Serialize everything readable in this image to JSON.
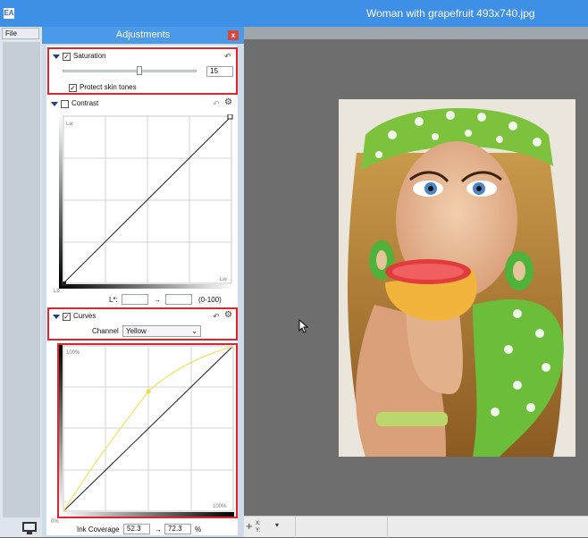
{
  "app": {
    "icon_text": "EA",
    "document_title": "Woman with grapefruit 493x740.jpg"
  },
  "menu": {
    "file": "File"
  },
  "panel": {
    "title": "Adjustments",
    "close": "x"
  },
  "saturation": {
    "label": "Saturation",
    "checked": true,
    "value": "15",
    "slider_fraction": 0.57,
    "protect_skin_label": "Protect skin tones",
    "protect_skin_checked": true
  },
  "contrast": {
    "label": "Contrast",
    "checked": false,
    "lw_top": "Lw",
    "lw_right": "Lw",
    "lb": "Lb",
    "l_star_label": "L*:",
    "from_value": "",
    "arrow": "→",
    "range_hint": "(0-100)"
  },
  "curves": {
    "label": "Curves",
    "checked": true,
    "channel_label": "Channel",
    "channel_value": "Yellow",
    "corner_top": "100%",
    "corner_bottom_right": "100%",
    "corner_bottom_left": "0%",
    "ink_coverage_label": "Ink Coverage",
    "ink_from": "52.3",
    "arrow": "→",
    "ink_to": "72.3",
    "percent": "%",
    "curve_color": "#f4e36a"
  },
  "statusbar": {
    "x_label": "X:",
    "y_label": "Y:"
  },
  "colors": {
    "titlebar": "#3e8fe6",
    "highlight": "#e0242d",
    "canvas_bg": "#6e6e6e"
  }
}
